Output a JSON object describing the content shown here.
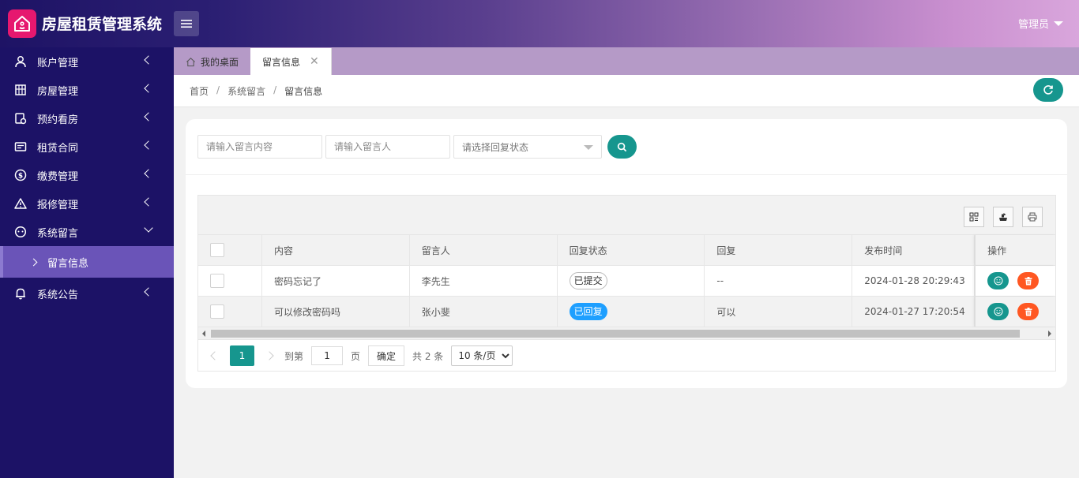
{
  "app": {
    "title": "房屋租赁管理系统",
    "user": "管理员"
  },
  "sidebar": {
    "items": [
      {
        "label": "账户管理",
        "icon": "user-icon"
      },
      {
        "label": "房屋管理",
        "icon": "building-icon"
      },
      {
        "label": "预约看房",
        "icon": "appointment-icon"
      },
      {
        "label": "租赁合同",
        "icon": "contract-icon"
      },
      {
        "label": "缴费管理",
        "icon": "dollar-icon"
      },
      {
        "label": "报修管理",
        "icon": "warning-icon"
      },
      {
        "label": "系统留言",
        "icon": "message-icon"
      }
    ],
    "sub_item": "留言信息",
    "last_item": {
      "label": "系统公告",
      "icon": "bell-icon"
    }
  },
  "tabs": {
    "home": "我的桌面",
    "active": "留言信息"
  },
  "breadcrumb": [
    "首页",
    "系统留言",
    "留言信息"
  ],
  "search": {
    "content_placeholder": "请输入留言内容",
    "user_placeholder": "请输入留言人",
    "status_placeholder": "请选择回复状态"
  },
  "table": {
    "headers": [
      "内容",
      "留言人",
      "回复状态",
      "回复",
      "发布时间",
      "操作"
    ],
    "rows": [
      {
        "content": "密码忘记了",
        "user": "李先生",
        "status": "已提交",
        "reply": "--",
        "time": "2024-01-28 20:29:43"
      },
      {
        "content": "可以修改密码吗",
        "user": "张小斐",
        "status": "已回复",
        "reply": "可以",
        "time": "2024-01-27 17:20:54"
      }
    ]
  },
  "pagination": {
    "current": "1",
    "goto_label": "到第",
    "page_input": "1",
    "page_unit": "页",
    "confirm": "确定",
    "total": "共 2 条",
    "page_size": "10 条/页"
  },
  "colors": {
    "primary": "#16968e",
    "sidebar": "#1c1266",
    "danger": "#ff5722",
    "info": "#1e9fff",
    "logo": "#e6186f"
  }
}
